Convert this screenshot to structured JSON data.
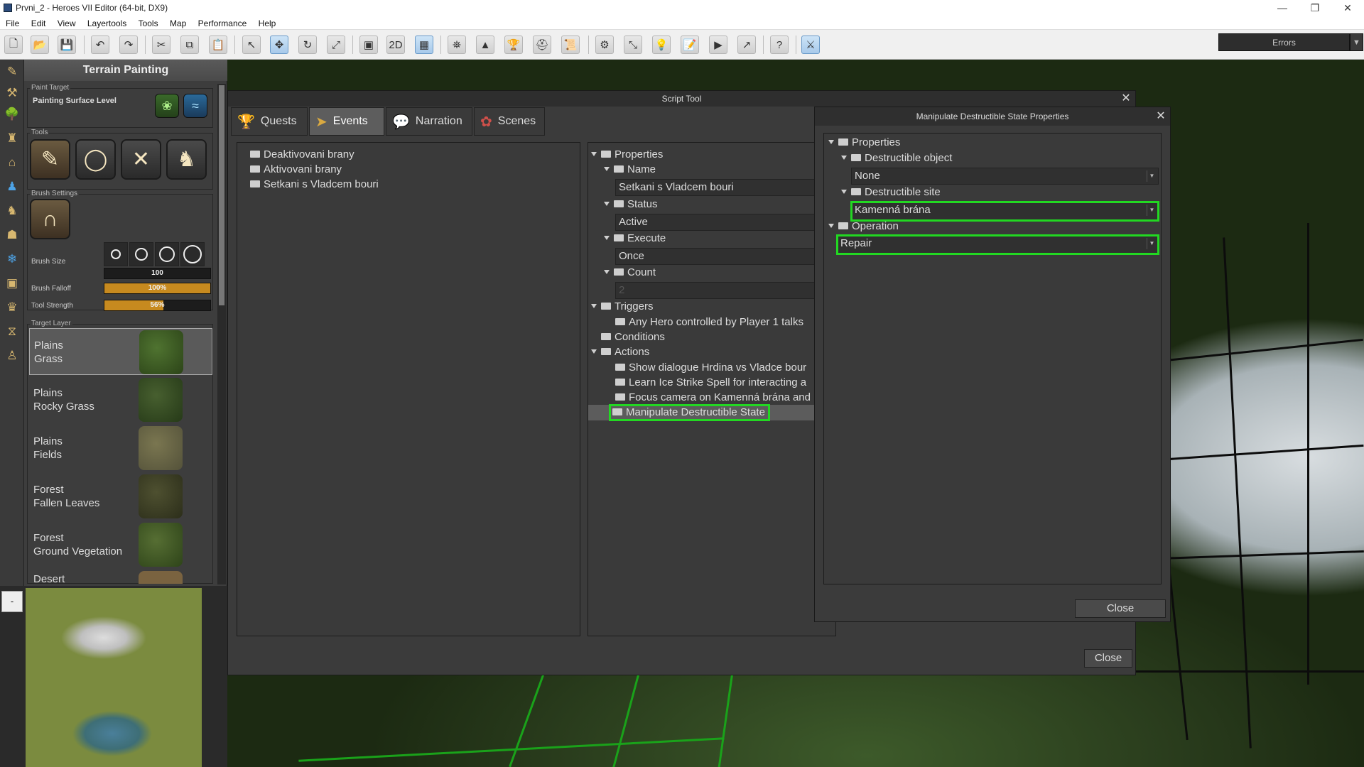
{
  "window": {
    "title": "Prvni_2 - Heroes VII Editor (64-bit, DX9)"
  },
  "menu": [
    "File",
    "Edit",
    "View",
    "Layertools",
    "Tools",
    "Map",
    "Performance",
    "Help"
  ],
  "errors_label": "Errors",
  "terrain": {
    "title": "Terrain Painting",
    "paint_target_label": "Paint Target",
    "painting_surface_level": "Painting Surface Level",
    "tools_label": "Tools",
    "brush_settings_label": "Brush Settings",
    "brush_size_label": "Brush Size",
    "brush_size_value": "100",
    "brush_falloff_label": "Brush Falloff",
    "brush_falloff_value": "100%",
    "brush_falloff_fraction": 1.0,
    "tool_strength_label": "Tool Strength",
    "tool_strength_value": "56%",
    "tool_strength_fraction": 0.56,
    "target_layer_label": "Target Layer",
    "layers": [
      {
        "line1": "Plains",
        "line2": "Grass",
        "color": "#3d5a28"
      },
      {
        "line1": "Plains",
        "line2": "Rocky Grass",
        "color": "#354a25"
      },
      {
        "line1": "Plains",
        "line2": "Fields",
        "color": "#6d6a45"
      },
      {
        "line1": "Forest",
        "line2": "Fallen Leaves",
        "color": "#3e4325"
      },
      {
        "line1": "Forest",
        "line2": "Ground Vegetation",
        "color": "#425a2a"
      },
      {
        "line1": "Desert",
        "line2": "",
        "color": "#7a6340"
      }
    ]
  },
  "minimap": {
    "button": "-"
  },
  "script_tool": {
    "title": "Script Tool",
    "tabs": [
      "Quests",
      "Events",
      "Narration",
      "Scenes"
    ],
    "events": [
      "Deaktivovani brany",
      "Aktivovani brany",
      "Setkani s Vladcem bouri"
    ],
    "properties": {
      "root": "Properties",
      "name_label": "Name",
      "name_value": "Setkani s Vladcem bouri",
      "status_label": "Status",
      "status_value": "Active",
      "execute_label": "Execute",
      "execute_value": "Once",
      "count_label": "Count",
      "count_value": "2",
      "triggers_label": "Triggers",
      "trigger_item": "Any Hero controlled by Player 1 talks",
      "conditions_label": "Conditions",
      "actions_label": "Actions",
      "actions": [
        "Show dialogue Hrdina vs Vladce bour",
        "Learn Ice Strike Spell for interacting a",
        "Focus camera on Kamenná brána and",
        "Manipulate Destructible State"
      ]
    },
    "close": "Close"
  },
  "manipulate": {
    "title": "Manipulate Destructible State Properties",
    "properties": "Properties",
    "destructible_object_label": "Destructible object",
    "destructible_object_value": "None",
    "destructible_site_label": "Destructible site",
    "destructible_site_value": "Kamenná brána",
    "operation_label": "Operation",
    "operation_value": "Repair",
    "close": "Close"
  }
}
